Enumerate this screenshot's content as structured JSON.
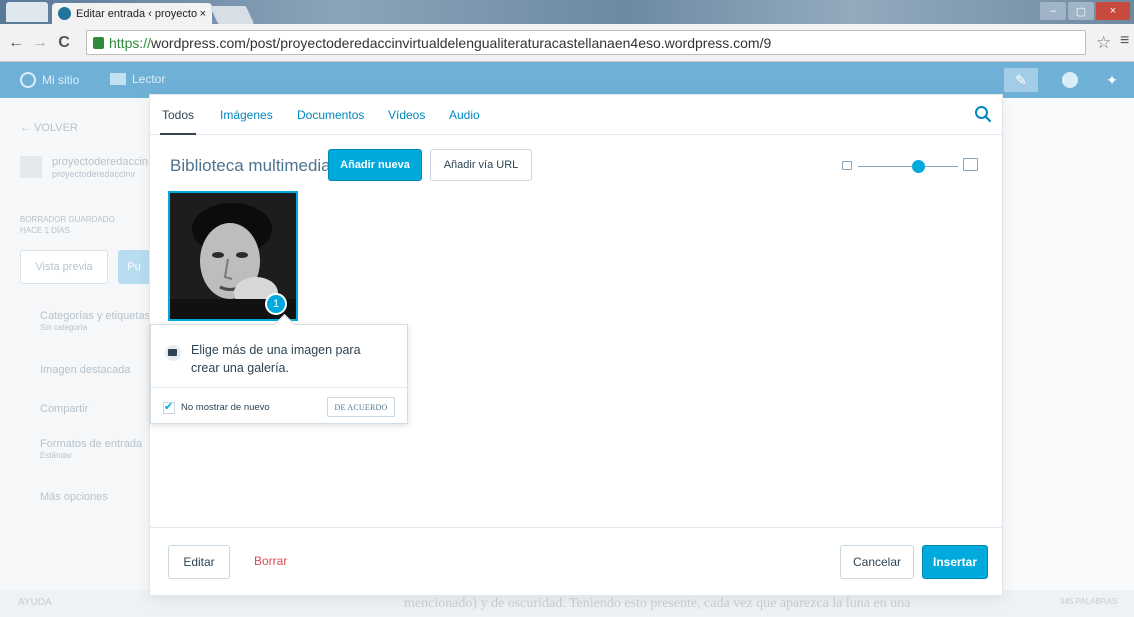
{
  "browser": {
    "tab_title": "Editar entrada ‹ proyecto",
    "tab_close": "×",
    "url_scheme": "https://",
    "url_rest": "wordpress.com/post/proyectoderedaccinvirtualdelengualiteraturacastellanaen4eso.wordpress.com/9",
    "back": "←",
    "forward": "→",
    "reload": "C",
    "bookmark": "☆",
    "menu": "≡",
    "minimize": "–",
    "maximize": "▢",
    "close": "×"
  },
  "admin_bar": {
    "my_site": "Mi sitio",
    "reader": "Lector"
  },
  "background": {
    "back_link": "← VOLVER",
    "site_name": "proyectoderedaccin",
    "site_url": "proyectoderedaccinv",
    "draft_status": "BORRADOR GUARDADO",
    "draft_time": "HACE 1 DÍAS",
    "preview_btn": "Vista previa",
    "publish_btn": "Pu",
    "categories": "Categorías y etiquetas",
    "categories_sub": "Sin categoría",
    "featured_image": "Imagen destacada",
    "share": "Compartir",
    "formats": "Formatos de entrada",
    "formats_sub": "Estándar",
    "more_options": "Más opciones",
    "bottom_text": "mencionado) y de oscuridad. Teniendo esto presente, cada vez que aparezca la luna en una",
    "bottom_left": "AYUDA",
    "bottom_right": "345 PALABRAS"
  },
  "modal": {
    "tabs": [
      "Todos",
      "Imágenes",
      "Documentos",
      "Vídeos",
      "Audio"
    ],
    "active_tab": 0,
    "title": "Biblioteca multimedia",
    "add_new": "Añadir nueva",
    "add_url": "Añadir vía URL",
    "zoom_level": 0.6,
    "selected_count": "1",
    "tooltip": {
      "message": "Elige más de una imagen para crear una galería.",
      "dont_show": "No mostrar de nuevo",
      "dont_show_checked": true,
      "ok": "DE ACUERDO"
    },
    "footer": {
      "edit": "Editar",
      "delete": "Borrar",
      "cancel": "Cancelar",
      "insert": "Insertar"
    }
  }
}
